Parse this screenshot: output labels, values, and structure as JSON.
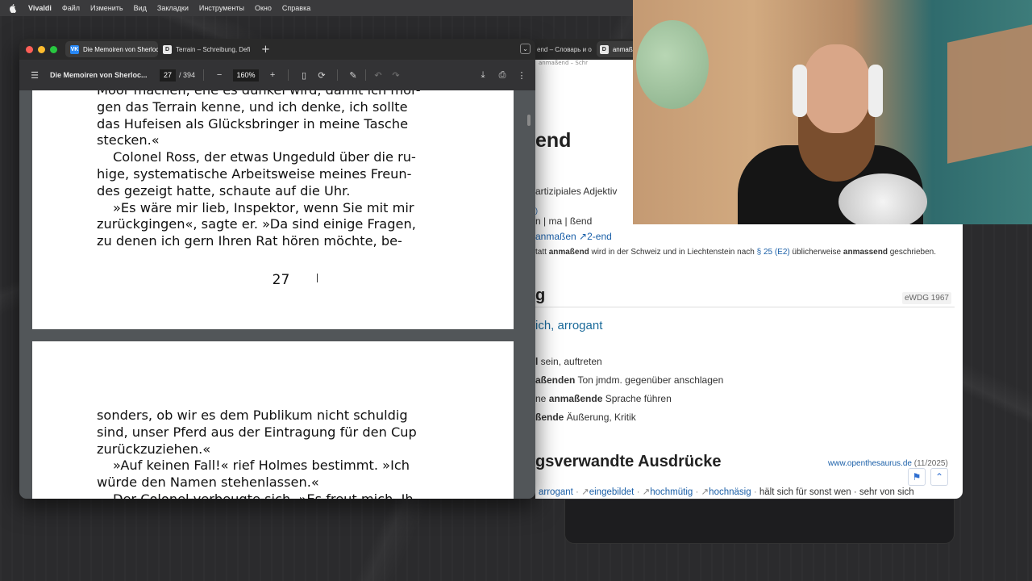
{
  "menubar": {
    "app_name": "Vivaldi",
    "items": [
      "Файл",
      "Изменить",
      "Вид",
      "Закладки",
      "Инструменты",
      "Окно",
      "Справка"
    ]
  },
  "pdf_window": {
    "tabs": [
      {
        "icon": "VK",
        "title": "Die Memoiren von Sherloc"
      },
      {
        "icon": "D",
        "title": "Terrain – Schreibung, Defi"
      }
    ],
    "toolbar": {
      "doc_title": "Die Memoiren von Sherloc...",
      "page_current": "27",
      "page_total": "/ 394",
      "zoom": "160%"
    },
    "page_a": {
      "lines": [
        {
          "text": "Moor machen, ehe es dunkel wird, damit ich mor-",
          "indent": false
        },
        {
          "text": "gen das Terrain kenne, und ich denke, ich sollte",
          "indent": false
        },
        {
          "text": "das Hufeisen als Glücksbringer in meine Tasche",
          "indent": false
        },
        {
          "text": "stecken.«",
          "indent": false
        },
        {
          "text": "Colonel Ross, der etwas Ungeduld über die ru-",
          "indent": true
        },
        {
          "text": "hige, systematische Arbeitsweise meines Freun-",
          "indent": false
        },
        {
          "text": "des gezeigt hatte, schaute auf die Uhr.",
          "indent": false
        },
        {
          "text": "»Es wäre mir lieb, Inspektor, wenn Sie mit mir",
          "indent": true
        },
        {
          "text": "zurückgingen«, sagte er. »Da sind einige Fragen,",
          "indent": false
        },
        {
          "text": "zu denen ich gern Ihren Rat hören möchte, be-",
          "indent": false
        }
      ],
      "page_number": "27"
    },
    "page_b": {
      "lines": [
        {
          "text": "sonders, ob wir es dem Publikum nicht schuldig",
          "indent": false
        },
        {
          "text": "sind, unser Pferd aus der Eintragung für den Cup",
          "indent": false
        },
        {
          "text": "zurückzuziehen.«",
          "indent": false
        },
        {
          "text": "»Auf keinen Fall!« rief Holmes bestimmt. »Ich",
          "indent": true
        },
        {
          "text": "würde den Namen stehenlassen.«",
          "indent": false
        },
        {
          "text": "Der Colonel verbeugte sich. »Es freut mich, Ih-",
          "indent": true
        }
      ]
    }
  },
  "browser": {
    "tabs": [
      "end – Словарь и о",
      "anmaßend"
    ],
    "tab_icon": "D",
    "url_fragment": "anmaßend – Schr",
    "headword": "end",
    "grammar": "artizipiales Adjektiv",
    "syllables": "n | ma | ßend",
    "etymology_link": "anmaßen",
    "etymology_ref": "2-end",
    "etymology_arrow": "↗",
    "orthography_note": {
      "prefix": "tatt",
      "word1": "anmaßend",
      "middle": "wird in der Schweiz und in Liechtenstein nach",
      "rule": "§ 25 (E2)",
      "middle2": "üblicherweise",
      "word2": "anmassend",
      "suffix": "geschrieben."
    },
    "section1_title": "g",
    "section1_badge": "eWDG 1967",
    "meaning": "ich, arrogant",
    "examples": [
      {
        "bold": "l",
        "rest": " sein, auftreten"
      },
      {
        "bold": "aßenden",
        "rest": " Ton jmdm. gegenüber anschlagen"
      },
      {
        "pre": "ne ",
        "bold": "anmaßende",
        "rest": " Sprache führen"
      },
      {
        "bold": "ßende",
        "rest": " Äußerung, Kritik"
      }
    ],
    "section2_title": "gsverwandte Ausdrücke",
    "section2_source": "www.openthesaurus.de",
    "section2_date": "(11/2025)",
    "synonyms": [
      "arrogant",
      "eingebildet",
      "hochmütig",
      "hochnäsig"
    ],
    "synonyms_plain": "hält sich für sonst wen · sehr von sich"
  }
}
